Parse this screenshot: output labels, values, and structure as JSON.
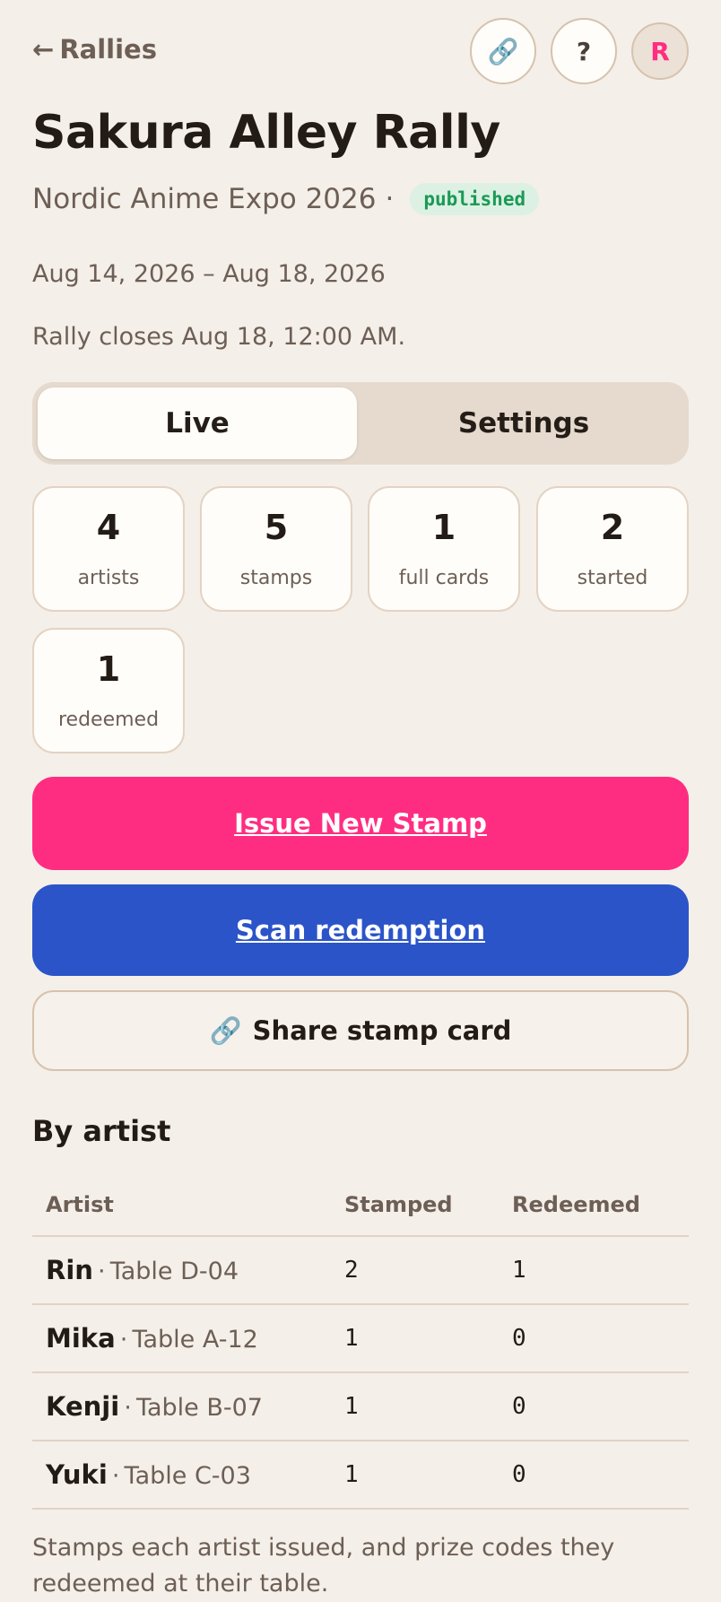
{
  "nav": {
    "back_label": "Rallies",
    "back_arrow": "←"
  },
  "top_actions": {
    "link_icon": "🔗",
    "help_label": "?",
    "avatar_initial": "R"
  },
  "rally": {
    "title": "Sakura Alley Rally",
    "event": "Nordic Anime Expo 2026",
    "separator": "·",
    "status": "published",
    "dates": "Aug 14, 2026 – Aug 18, 2026",
    "closes": "Rally closes Aug 18, 12:00 AM."
  },
  "tabs": [
    {
      "label": "Live",
      "active": true
    },
    {
      "label": "Settings",
      "active": false
    }
  ],
  "stats": [
    {
      "value": "4",
      "label": "artists"
    },
    {
      "value": "5",
      "label": "stamps"
    },
    {
      "value": "1",
      "label": "full cards"
    },
    {
      "value": "2",
      "label": "started"
    },
    {
      "value": "1",
      "label": "redeemed"
    }
  ],
  "actions": {
    "issue_label": "Issue New Stamp",
    "scan_label": "Scan redemption",
    "share_icon": "🔗",
    "share_label": "Share stamp card"
  },
  "by_artist": {
    "title": "By artist",
    "columns": [
      "Artist",
      "Stamped",
      "Redeemed"
    ],
    "rows": [
      {
        "name": "Rin",
        "sep": "·",
        "table": "Table D-04",
        "stamped": "2",
        "redeemed": "1"
      },
      {
        "name": "Mika",
        "sep": "·",
        "table": "Table A-12",
        "stamped": "1",
        "redeemed": "0"
      },
      {
        "name": "Kenji",
        "sep": "·",
        "table": "Table B-07",
        "stamped": "1",
        "redeemed": "0"
      },
      {
        "name": "Yuki",
        "sep": "·",
        "table": "Table C-03",
        "stamped": "1",
        "redeemed": "0"
      }
    ],
    "footnote": "Stamps each artist issued, and prize codes they redeemed at their table."
  },
  "colors": {
    "accent_pink": "#ff2d82",
    "accent_blue": "#2b54c9",
    "status_green": "#1a9a55",
    "background": "#f4efe9"
  }
}
